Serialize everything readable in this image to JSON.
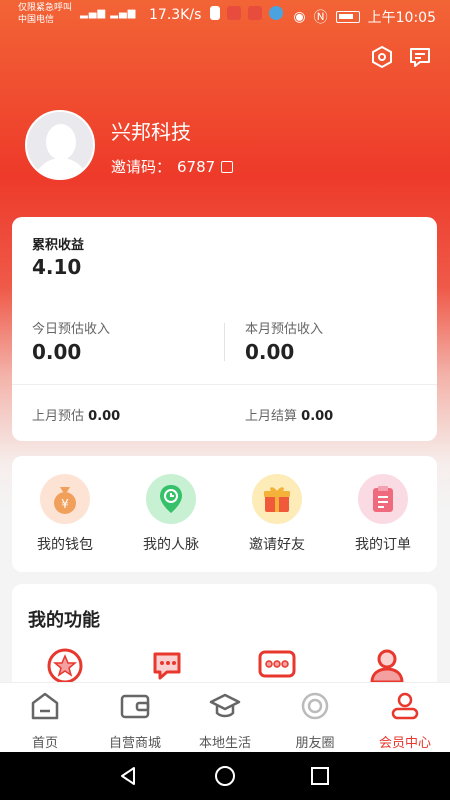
{
  "status_bar": {
    "carrier_line1": "仅限紧急呼叫",
    "carrier_line2": "中国电信",
    "net_speed": "17.3K/s",
    "time": "上午10:05"
  },
  "header": {
    "icons": [
      "settings-hexagon-icon",
      "message-icon"
    ]
  },
  "profile": {
    "name": "兴邦科技",
    "invite_label": "邀请码：",
    "invite_code": "6787"
  },
  "earnings": {
    "total_label": "累积收益",
    "total_value": "4.10",
    "today_label": "今日预估收入",
    "today_value": "0.00",
    "month_label": "本月预估收入",
    "month_value": "0.00",
    "last_month_est_label": "上月预估",
    "last_month_est_value": "0.00",
    "last_month_settle_label": "上月结算",
    "last_month_settle_value": "0.00"
  },
  "quick_actions": [
    {
      "label": "我的钱包",
      "icon": "money-bag-icon",
      "color": "#f0a05a"
    },
    {
      "label": "我的人脉",
      "icon": "location-pin-icon",
      "color": "#37c06a"
    },
    {
      "label": "邀请好友",
      "icon": "gift-icon",
      "color": "#f4b23a"
    },
    {
      "label": "我的订单",
      "icon": "order-list-icon",
      "color": "#f06a7e"
    }
  ],
  "functions": {
    "title": "我的功能",
    "icons": [
      "star-badge-icon",
      "chat-bubbles-icon",
      "message-dots-icon",
      "user-icon"
    ]
  },
  "tabs": [
    {
      "label": "首页",
      "icon": "home-icon"
    },
    {
      "label": "自营商城",
      "icon": "wallet-icon"
    },
    {
      "label": "本地生活",
      "icon": "graduation-cap-icon"
    },
    {
      "label": "朋友圈",
      "icon": "circle-icon"
    },
    {
      "label": "会员中心",
      "icon": "member-user-icon",
      "active": true
    }
  ],
  "colors": {
    "accent": "#e8372c",
    "header_top": "#f26436",
    "header_mid": "#ee3a2a"
  }
}
